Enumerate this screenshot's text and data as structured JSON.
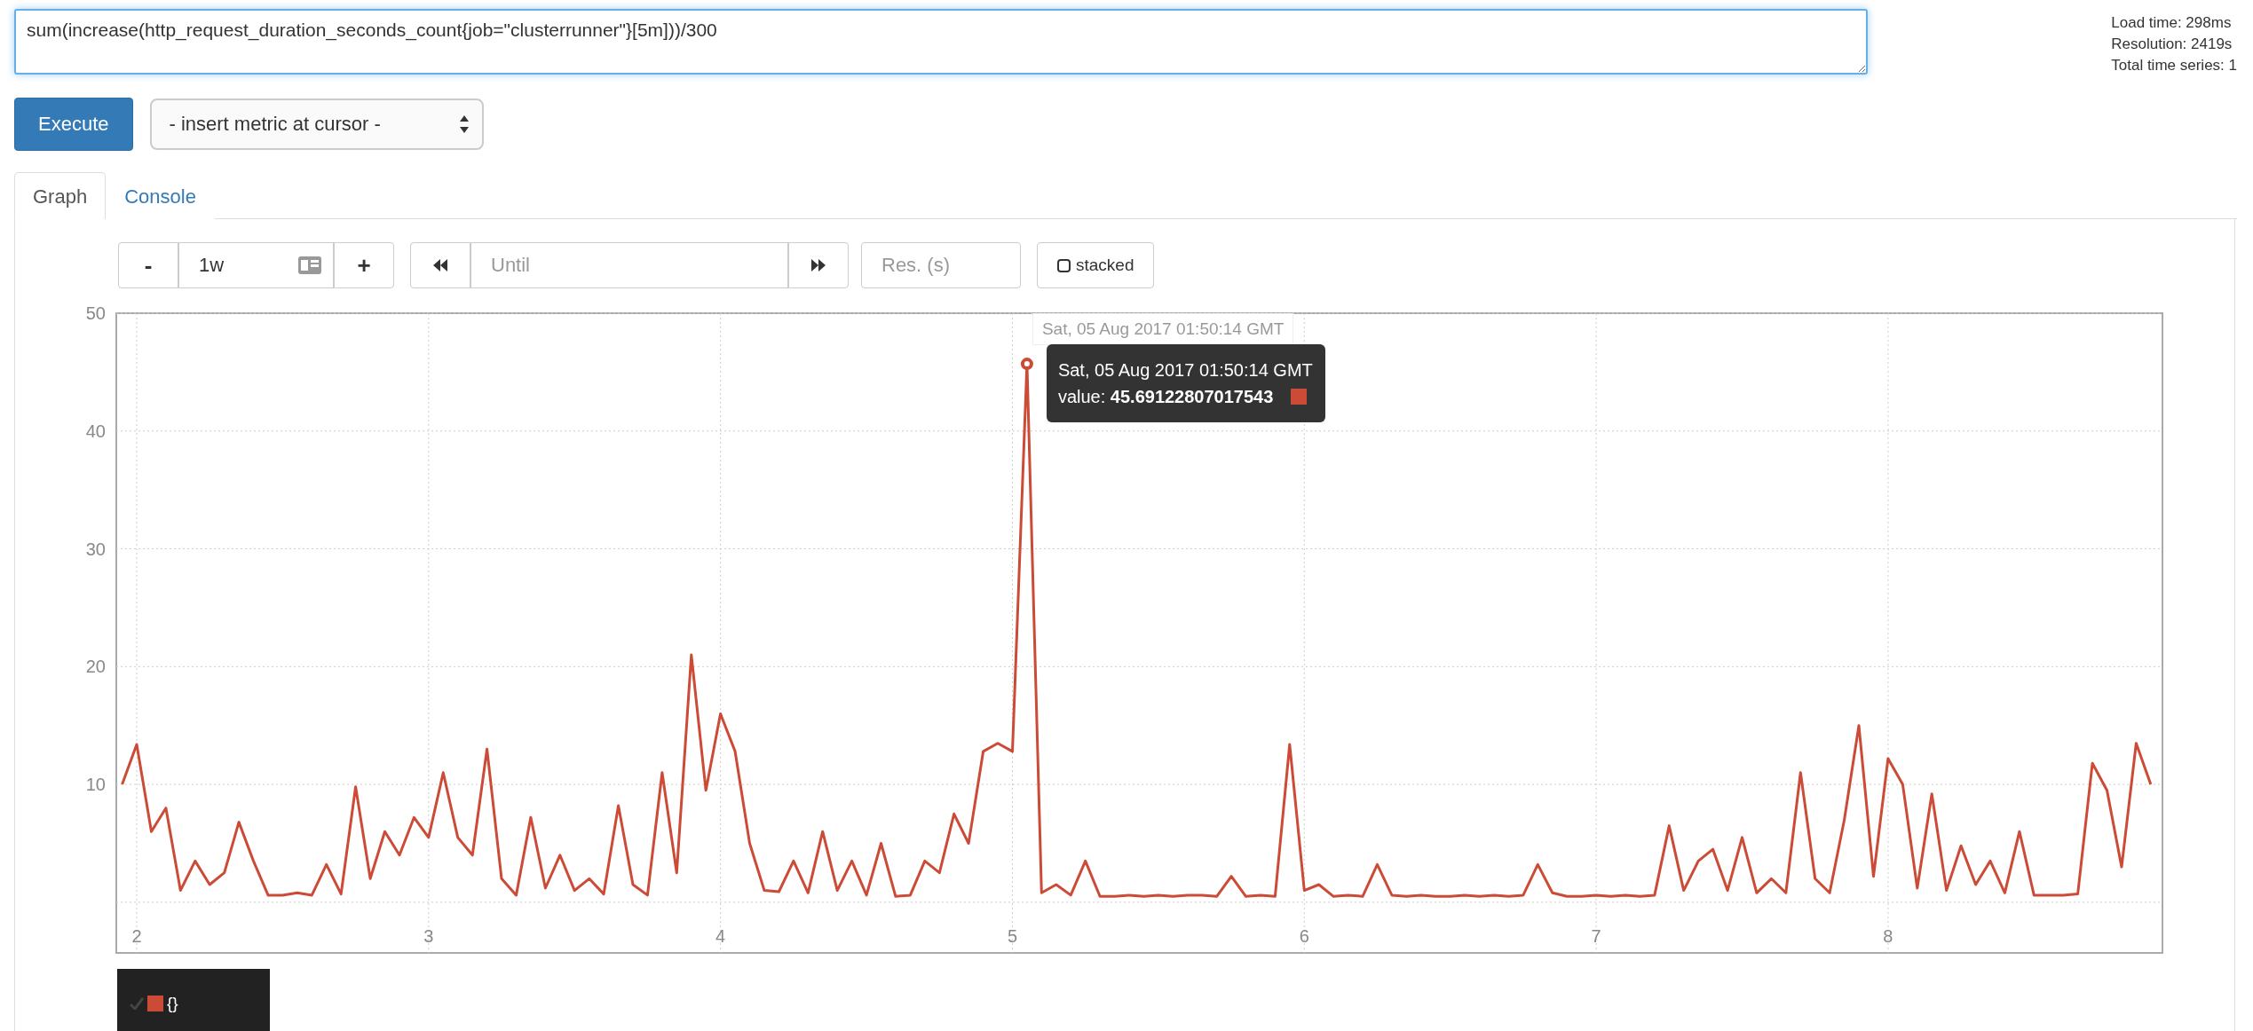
{
  "query": {
    "value": "sum(increase(http_request_duration_seconds_count{job=\"clusterrunner\"}[5m]))/300"
  },
  "stats": [
    "Load time: 298ms",
    "Resolution: 2419s",
    "Total time series: 1"
  ],
  "execute_button": "Execute",
  "metric_select": "- insert metric at cursor -",
  "tabs": [
    {
      "label": "Graph",
      "selected": true
    },
    {
      "label": "Console",
      "selected": false
    }
  ],
  "controls": {
    "shrink_range": "-",
    "range": "1w",
    "grow_range": "+",
    "end_time": {
      "placeholder": "Until"
    },
    "resolution": {
      "placeholder": "Res. (s)"
    },
    "stacked": {
      "label": "stacked",
      "checked": false
    }
  },
  "chart_data": {
    "type": "line",
    "grid": true,
    "xlim": [
      1.93,
      8.94
    ],
    "ylim": [
      -4.3,
      50
    ],
    "xticks": [
      2,
      3,
      4,
      5,
      6,
      7,
      8
    ],
    "yticks": [
      10,
      20,
      30,
      40,
      50
    ],
    "x": [
      1.95,
      2.0,
      2.05,
      2.1,
      2.15,
      2.2,
      2.25,
      2.3,
      2.35,
      2.4,
      2.45,
      2.5,
      2.55,
      2.6,
      2.65,
      2.7,
      2.75,
      2.8,
      2.85,
      2.9,
      2.95,
      3.0,
      3.05,
      3.1,
      3.15,
      3.2,
      3.25,
      3.3,
      3.35,
      3.4,
      3.45,
      3.5,
      3.55,
      3.6,
      3.65,
      3.7,
      3.75,
      3.8,
      3.85,
      3.9,
      3.95,
      4.0,
      4.05,
      4.1,
      4.15,
      4.2,
      4.25,
      4.3,
      4.35,
      4.4,
      4.45,
      4.5,
      4.55,
      4.6,
      4.65,
      4.7,
      4.75,
      4.8,
      4.85,
      4.9,
      4.95,
      5.0,
      5.05,
      5.1,
      5.15,
      5.2,
      5.25,
      5.3,
      5.35,
      5.4,
      5.45,
      5.5,
      5.55,
      5.6,
      5.65,
      5.7,
      5.75,
      5.8,
      5.85,
      5.9,
      5.95,
      6.0,
      6.05,
      6.1,
      6.15,
      6.2,
      6.25,
      6.3,
      6.35,
      6.4,
      6.45,
      6.5,
      6.55,
      6.6,
      6.65,
      6.7,
      6.75,
      6.8,
      6.85,
      6.9,
      6.95,
      7.0,
      7.05,
      7.1,
      7.15,
      7.2,
      7.25,
      7.3,
      7.35,
      7.4,
      7.45,
      7.5,
      7.55,
      7.6,
      7.65,
      7.7,
      7.75,
      7.8,
      7.85,
      7.9,
      7.95,
      8.0,
      8.05,
      8.1,
      8.15,
      8.2,
      8.25,
      8.3,
      8.35,
      8.4,
      8.45,
      8.5,
      8.55,
      8.6,
      8.65,
      8.7,
      8.75,
      8.8,
      8.85,
      8.9
    ],
    "series": [
      {
        "name": "{}",
        "color": "#cc4b37",
        "values": [
          10,
          13.4,
          6,
          8,
          1,
          3.5,
          1.5,
          2.5,
          6.8,
          3.5,
          0.6,
          0.6,
          0.8,
          0.6,
          3.2,
          0.7,
          9.8,
          2,
          6,
          4,
          7.2,
          5.5,
          11,
          5.5,
          4,
          13,
          2,
          0.6,
          7.2,
          1.2,
          4,
          1,
          2,
          0.7,
          8.2,
          1.5,
          0.6,
          11,
          2.5,
          21,
          9.5,
          16,
          12.8,
          5,
          1,
          0.9,
          3.5,
          0.8,
          6,
          1,
          3.5,
          0.6,
          5,
          0.5,
          0.6,
          3.5,
          2.5,
          7.5,
          5,
          12.8,
          13.5,
          12.8,
          45.7,
          0.8,
          1.5,
          0.6,
          3.5,
          0.5,
          0.5,
          0.6,
          0.5,
          0.6,
          0.5,
          0.6,
          0.6,
          0.5,
          2.2,
          0.5,
          0.6,
          0.5,
          13.4,
          1,
          1.5,
          0.5,
          0.6,
          0.5,
          3.2,
          0.6,
          0.5,
          0.6,
          0.5,
          0.5,
          0.6,
          0.5,
          0.6,
          0.5,
          0.6,
          3.2,
          0.8,
          0.5,
          0.5,
          0.6,
          0.5,
          0.6,
          0.5,
          0.6,
          6.5,
          1,
          3.5,
          4.5,
          1,
          5.5,
          0.8,
          2,
          0.8,
          11,
          2,
          0.8,
          7,
          15,
          2.2,
          12.2,
          10,
          1.2,
          9.2,
          1,
          4.8,
          1.5,
          3.5,
          0.8,
          6,
          0.6,
          0.6,
          0.6,
          0.7,
          11.8,
          9.5,
          3,
          13.5,
          10
        ]
      }
    ]
  },
  "hover": {
    "axis_label": "Sat, 05 Aug 2017 01:50:14 GMT",
    "time": "Sat, 05 Aug 2017 01:50:14 GMT",
    "value_label": "value:",
    "value": "45.69122807017543"
  },
  "legend": [
    {
      "checked": true
    }
  ]
}
